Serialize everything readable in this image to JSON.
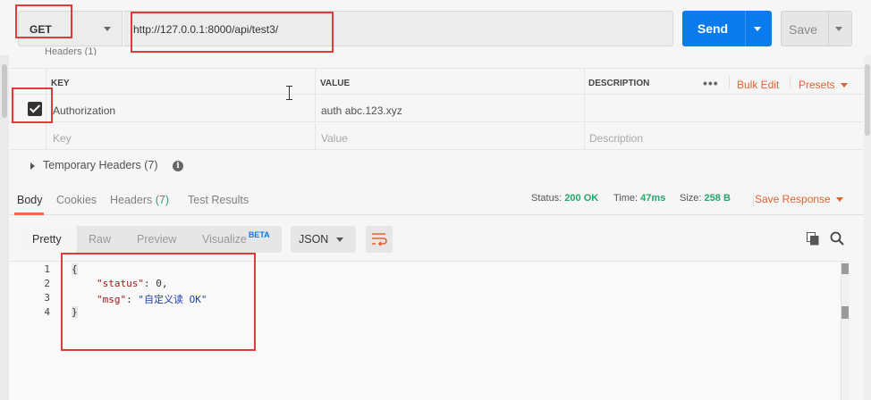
{
  "request": {
    "method": "GET",
    "url": "http://127.0.0.1:8000/api/test3/",
    "send_label": "Send",
    "save_label": "Save"
  },
  "headers_section": {
    "cut_title": "Headers (1)",
    "columns": {
      "key": "KEY",
      "value": "VALUE",
      "description": "DESCRIPTION"
    },
    "bulk_edit": "Bulk Edit",
    "presets": "Presets",
    "rows": [
      {
        "checked": true,
        "key": "Authorization",
        "value": "auth abc.123.xyz",
        "description": ""
      }
    ],
    "placeholder": {
      "key": "Key",
      "value": "Value",
      "description": "Description"
    },
    "temporary_label": "Temporary Headers",
    "temporary_count": "(7)"
  },
  "response": {
    "tabs": [
      {
        "label": "Body",
        "count": ""
      },
      {
        "label": "Cookies",
        "count": ""
      },
      {
        "label": "Headers",
        "count": "(7)"
      },
      {
        "label": "Test Results",
        "count": ""
      }
    ],
    "status_label": "Status:",
    "status_value": "200 OK",
    "time_label": "Time:",
    "time_value": "47ms",
    "size_label": "Size:",
    "size_value": "258 B",
    "save_response": "Save Response",
    "views": [
      "Pretty",
      "Raw",
      "Preview",
      "Visualize"
    ],
    "beta": "BETA",
    "format": "JSON",
    "code": {
      "line_numbers": [
        "1",
        "2",
        "3",
        "4"
      ],
      "open_brace": "{",
      "status_key": "\"status\"",
      "status_value": "0",
      "msg_key": "\"msg\"",
      "msg_value": "\"自定义读 OK\"",
      "close_brace": "}"
    }
  },
  "colors": {
    "accent": "#097bed",
    "orange": "#e0632f",
    "success": "#26a66a",
    "annotation": "#e03a3a"
  }
}
